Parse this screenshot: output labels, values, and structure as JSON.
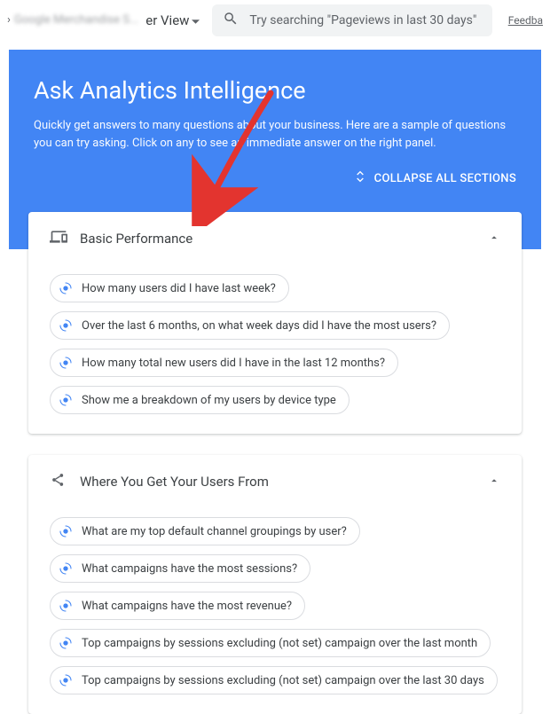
{
  "topbar": {
    "breadcrumb_sep": "›",
    "breadcrumb_property": "Google Merchandise S...",
    "view_label": "er View",
    "feedback_label": "Feedba"
  },
  "search": {
    "placeholder": "Try searching \"Pageviews in last 30 days\""
  },
  "hero": {
    "title": "Ask Analytics Intelligence",
    "subtitle": "Quickly get answers to many questions about your business. Here are a sample of questions you can try asking. Click on any to see an immediate answer on the right panel.",
    "collapse_label": "COLLAPSE ALL SECTIONS"
  },
  "sections": [
    {
      "title": "Basic Performance",
      "icon": "devices",
      "chips": [
        "How many users did I have last week?",
        "Over the last 6 months, on what week days did I have the most users?",
        "How many total new users did I have in the last 12 months?",
        "Show me a breakdown of my users by device type"
      ]
    },
    {
      "title": "Where You Get Your Users From",
      "icon": "share",
      "chips": [
        "What are my top default channel groupings by user?",
        "What campaigns have the most sessions?",
        "What campaigns have the most revenue?",
        "Top campaigns by sessions excluding (not set) campaign over the last month",
        "Top campaigns by sessions excluding (not set) campaign over the last 30 days"
      ]
    }
  ]
}
